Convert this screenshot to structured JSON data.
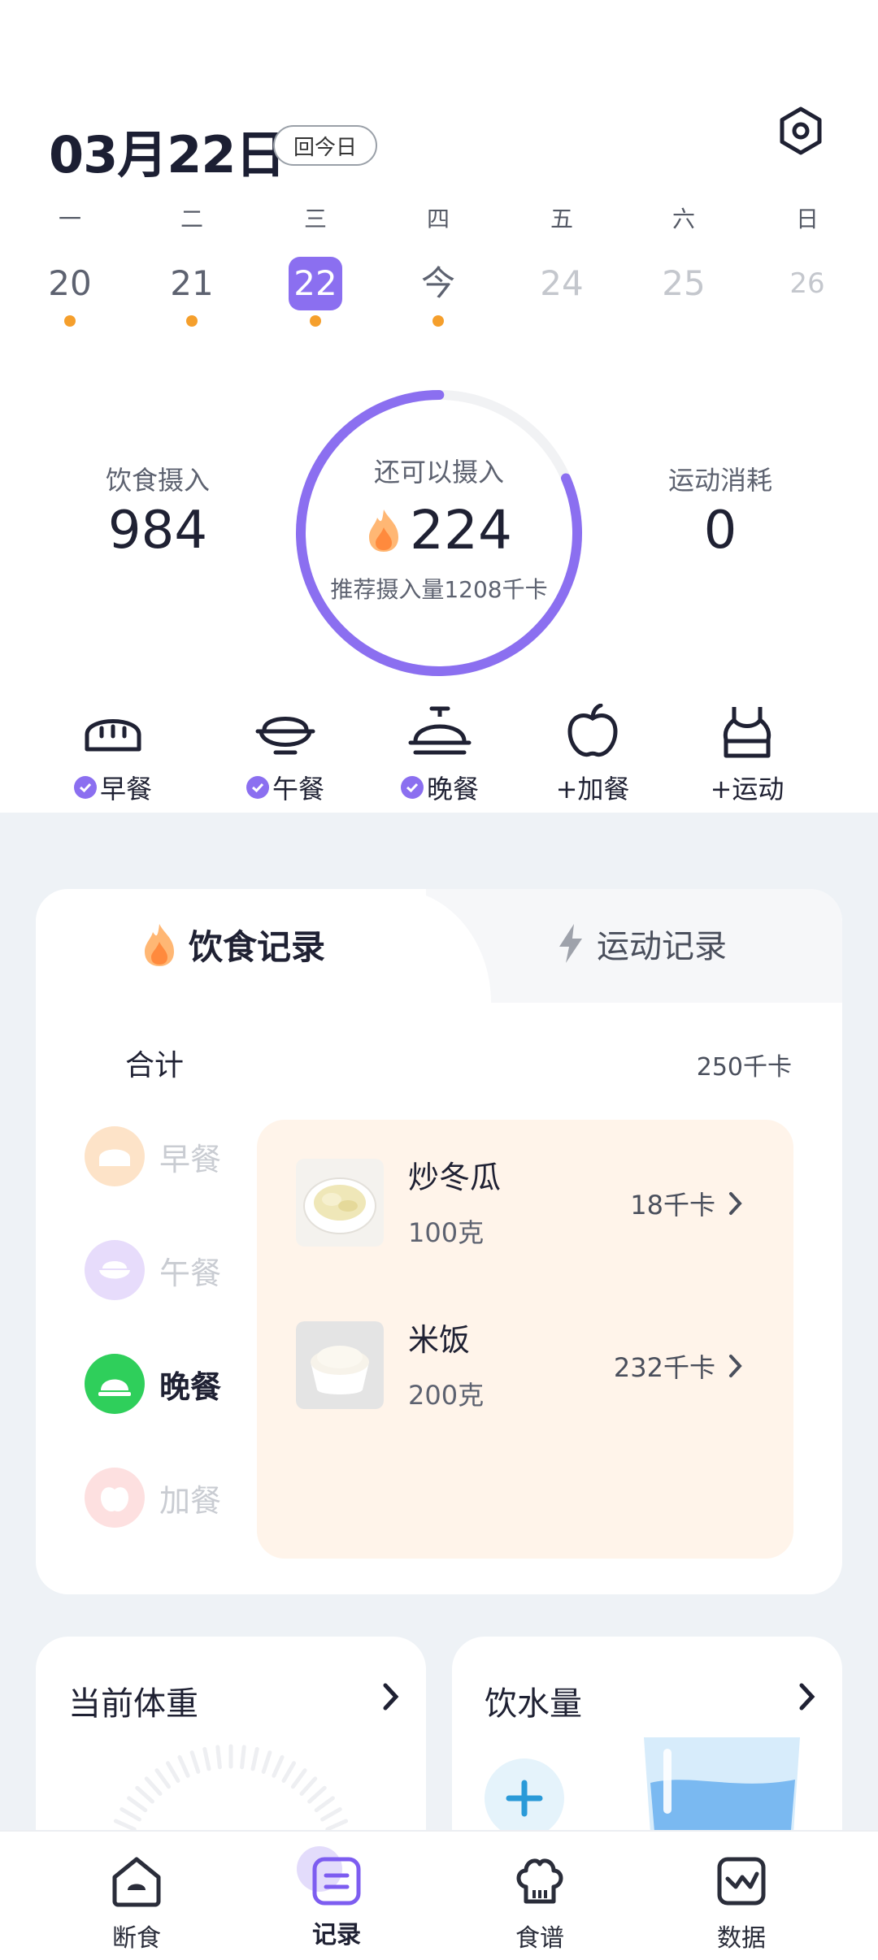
{
  "header": {
    "date": "03月22日",
    "today_button": "回今日"
  },
  "week": [
    {
      "weekday": "一",
      "day": "20",
      "state": "past",
      "dot": true
    },
    {
      "weekday": "二",
      "day": "21",
      "state": "past",
      "dot": true
    },
    {
      "weekday": "三",
      "day": "22",
      "state": "selected",
      "dot": true
    },
    {
      "weekday": "四",
      "day": "今",
      "state": "today",
      "dot": true
    },
    {
      "weekday": "五",
      "day": "24",
      "state": "future",
      "dot": false
    },
    {
      "weekday": "六",
      "day": "25",
      "state": "future",
      "dot": false
    },
    {
      "weekday": "日",
      "day": "26",
      "state": "future",
      "dot": false
    }
  ],
  "summary": {
    "intake_label": "饮食摄入",
    "intake_value": "984",
    "remain_label": "还可以摄入",
    "remain_value": "224",
    "recommend": "推荐摄入量1208千卡",
    "burn_label": "运动消耗",
    "burn_value": "0",
    "ring_progress": 0.815,
    "ring_color": "#8b6ff0"
  },
  "meal_buttons": [
    {
      "label": "早餐",
      "checked": true,
      "icon": "bread-icon"
    },
    {
      "label": "午餐",
      "checked": true,
      "icon": "rice-bowl-icon"
    },
    {
      "label": "晚餐",
      "checked": true,
      "icon": "cloche-icon"
    },
    {
      "label": "+加餐",
      "checked": false,
      "icon": "apple-icon"
    },
    {
      "label": "+运动",
      "checked": false,
      "icon": "tank-top-icon"
    }
  ],
  "records": {
    "tab_diet": "饮食记录",
    "tab_sport": "运动记录",
    "total_label": "合计",
    "total_value": "250千卡",
    "side_meals": [
      {
        "label": "早餐",
        "active": false,
        "color": "#fde3c8"
      },
      {
        "label": "午餐",
        "active": false,
        "color": "#e7dcfb"
      },
      {
        "label": "晚餐",
        "active": true,
        "color": "#2fcf5b"
      },
      {
        "label": "加餐",
        "active": false,
        "color": "#fde0e0"
      }
    ],
    "foods": [
      {
        "name": "炒冬瓜",
        "qty": "100克",
        "kcal": "18千卡"
      },
      {
        "name": "米饭",
        "qty": "200克",
        "kcal": "232千卡"
      }
    ]
  },
  "cards": {
    "weight_title": "当前体重",
    "water_title": "饮水量"
  },
  "nav": [
    {
      "label": "断食",
      "icon": "house-icon",
      "active": false
    },
    {
      "label": "记录",
      "icon": "record-icon",
      "active": true
    },
    {
      "label": "食谱",
      "icon": "chef-hat-icon",
      "active": false
    },
    {
      "label": "数据",
      "icon": "chart-icon",
      "active": false
    }
  ]
}
